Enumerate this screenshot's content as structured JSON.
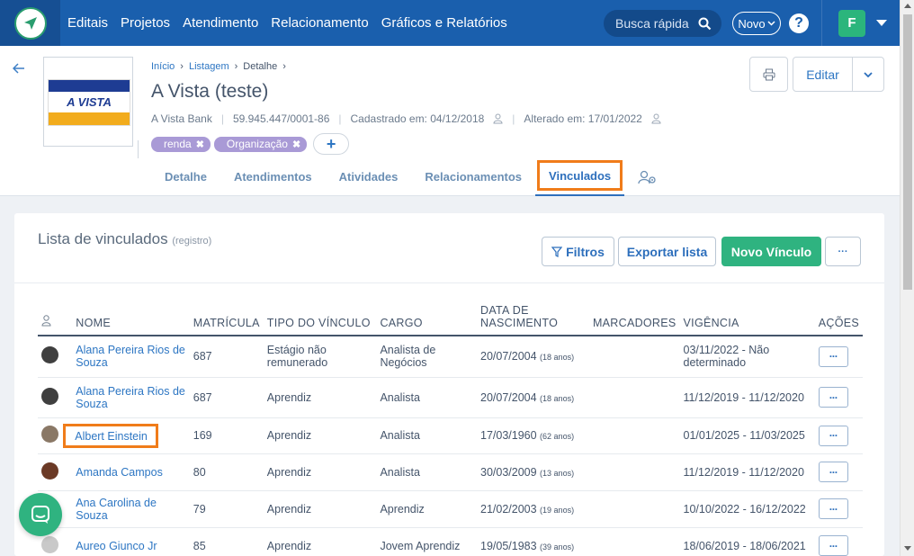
{
  "nav": {
    "items": [
      "Editais",
      "Projetos",
      "Atendimento",
      "Relacionamento",
      "Gráficos e Relatórios"
    ],
    "search_placeholder": "Busca rápida",
    "novo_label": "Novo",
    "help_label": "?",
    "user_initial": "F"
  },
  "header": {
    "breadcrumb": [
      "Início",
      "Listagem",
      "Detalhe"
    ],
    "logo_text": "A VISTA",
    "title": "A Vista (teste)",
    "meta": {
      "company": "A Vista Bank",
      "cnpj": "59.945.447/0001-86",
      "created": "Cadastrado em: 04/12/2018",
      "updated": "Alterado em: 17/01/2022"
    },
    "tags": [
      "renda",
      "Organização"
    ],
    "edit_label": "Editar",
    "tabs": [
      "Detalhe",
      "Atendimentos",
      "Atividades",
      "Relacionamentos",
      "Vinculados"
    ],
    "active_tab": "Vinculados"
  },
  "list": {
    "title": "Lista de vinculados",
    "subtitle": "(registro)",
    "buttons": {
      "filters": "Filtros",
      "export": "Exportar lista",
      "new": "Novo Vínculo",
      "more": "···"
    },
    "columns": [
      "NOME",
      "MATRÍCULA",
      "TIPO DO VÍNCULO",
      "CARGO",
      "DATA DE NASCIMENTO",
      "MARCADORES",
      "VIGÊNCIA",
      "AÇÕES"
    ],
    "rows": [
      {
        "name": "Alana Pereira Rios de Souza",
        "matricula": "687",
        "tipo": "Estágio não remunerado",
        "cargo": "Analista de Negócios",
        "nascimento": "20/07/2004",
        "idade": "(18 anos)",
        "marcadores": "",
        "vigencia": "03/11/2022 - Não determinado",
        "avatar_color": "#3f3f3f"
      },
      {
        "name": "Alana Pereira Rios de Souza",
        "matricula": "687",
        "tipo": "Aprendiz",
        "cargo": "Analista",
        "nascimento": "20/07/2004",
        "idade": "(18 anos)",
        "marcadores": "",
        "vigencia": "11/12/2019 - 11/12/2020",
        "avatar_color": "#3f3f3f"
      },
      {
        "name": "Albert Einstein",
        "matricula": "169",
        "tipo": "Aprendiz",
        "cargo": "Analista",
        "nascimento": "17/03/1960",
        "idade": "(62 anos)",
        "marcadores": "",
        "vigencia": "01/01/2025 - 11/03/2025",
        "avatar_color": "#8a7866"
      },
      {
        "name": "Amanda Campos",
        "matricula": "80",
        "tipo": "Aprendiz",
        "cargo": "Analista",
        "nascimento": "30/03/2009",
        "idade": "(13 anos)",
        "marcadores": "",
        "vigencia": "11/12/2019 - 11/12/2020",
        "avatar_color": "#6b3a26"
      },
      {
        "name": "Ana Carolina de Souza",
        "matricula": "79",
        "tipo": "Aprendiz",
        "cargo": "Aprendiz",
        "nascimento": "21/02/2003",
        "idade": "(19 anos)",
        "marcadores": "",
        "vigencia": "10/10/2022 - 16/12/2022",
        "avatar_color": ""
      },
      {
        "name": "Aureo Giunco Jr",
        "matricula": "85",
        "tipo": "Aprendiz",
        "cargo": "Jovem Aprendiz",
        "nascimento": "19/05/1983",
        "idade": "(39 anos)",
        "marcadores": "",
        "vigencia": "18/06/2019 - 18/06/2021",
        "avatar_color": "#c9c9c9"
      }
    ],
    "action_label": "···"
  },
  "colors": {
    "primary": "#1a5fad",
    "accent_green": "#2fb380",
    "highlight": "#f07c1a",
    "tag": "#a99ad6"
  }
}
